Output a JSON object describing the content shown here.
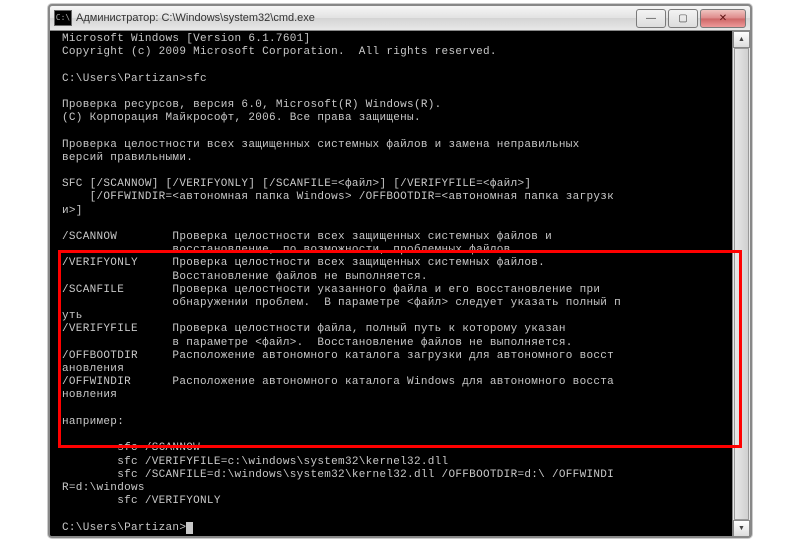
{
  "window": {
    "icon_label": "C:\\",
    "title": "Администратор: C:\\Windows\\system32\\cmd.exe",
    "buttons": {
      "min": "—",
      "max": "▢",
      "close": "✕"
    }
  },
  "lines": {
    "l0": "Microsoft Windows [Version 6.1.7601]",
    "l1": "Copyright (c) 2009 Microsoft Corporation.  All rights reserved.",
    "l2": "",
    "l3": "C:\\Users\\Partizan>sfc",
    "l4": "",
    "l5": "Проверка ресурсов, версия 6.0, Microsoft(R) Windows(R).",
    "l6": "(С) Корпорация Майкрософт, 2006. Все права защищены.",
    "l7": "",
    "l8": "Проверка целостности всех защищенных системных файлов и замена неправильных",
    "l9": "версий правильными.",
    "l10": "",
    "l11": "SFC [/SCANNOW] [/VERIFYONLY] [/SCANFILE=<файл>] [/VERIFYFILE=<файл>]",
    "l12": "    [/OFFWINDIR=<автономная папка Windows> /OFFBOOTDIR=<автономная папка загрузк",
    "l13": "и>]",
    "l14": "",
    "l15": "/SCANNOW        Проверка целостности всех защищенных системных файлов и",
    "l16": "                восстановление, по возможности, проблемных файлов.",
    "l17": "/VERIFYONLY     Проверка целостности всех защищенных системных файлов.",
    "l18": "                Восстановление файлов не выполняется.",
    "l19": "/SCANFILE       Проверка целостности указанного файла и его восстановление при",
    "l20": "                обнаружении проблем.  В параметре <файл> следует указать полный п",
    "l21": "уть",
    "l22": "/VERIFYFILE     Проверка целостности файла, полный путь к которому указан",
    "l23": "                в параметре <файл>.  Восстановление файлов не выполняется.",
    "l24": "/OFFBOOTDIR     Расположение автономного каталога загрузки для автономного восст",
    "l25": "ановления",
    "l26": "/OFFWINDIR      Расположение автономного каталога Windows для автономного восста",
    "l27": "новления",
    "l28": "",
    "l29": "например:",
    "l30": "",
    "l31": "        sfc /SCANNOW",
    "l32": "        sfc /VERIFYFILE=c:\\windows\\system32\\kernel32.dll",
    "l33": "        sfc /SCANFILE=d:\\windows\\system32\\kernel32.dll /OFFBOOTDIR=d:\\ /OFFWINDI",
    "l34": "R=d:\\windows",
    "l35": "        sfc /VERIFYONLY",
    "l36": "",
    "l37": "C:\\Users\\Partizan>"
  },
  "scrollbar": {
    "up": "▲",
    "down": "▼"
  }
}
